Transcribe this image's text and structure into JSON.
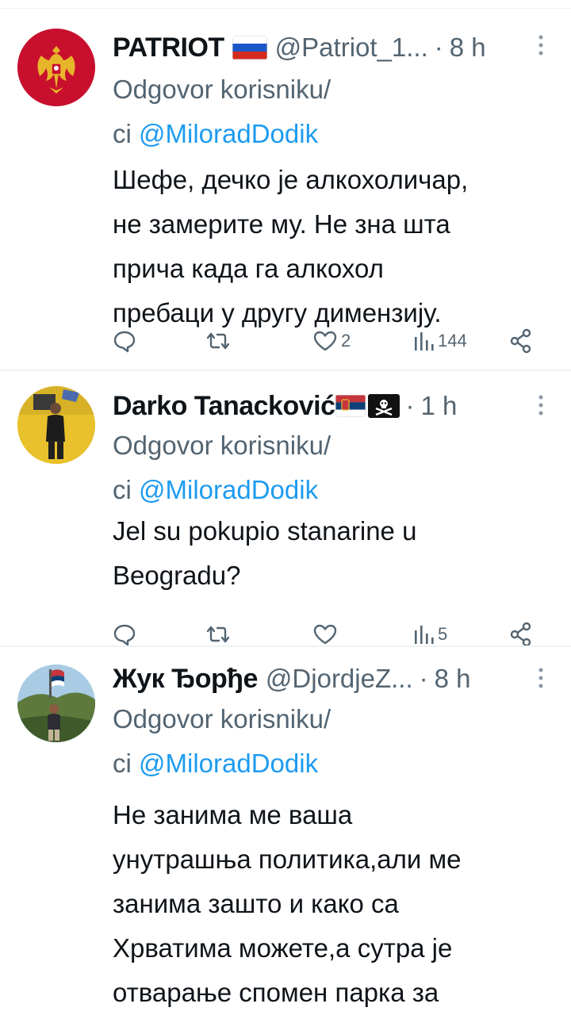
{
  "reply_prefix": "Odgovor korisniku/",
  "reply_prefix2": "ci",
  "tweets": [
    {
      "display_name": "PATRIOT",
      "handle": "@Patriot_1...",
      "time": "8 h",
      "reply_mention": "@MiloradDodik",
      "lines": [
        "Шефе, дечко је алкохоличар,",
        "не замерите му. Не зна шта",
        "прича када га алкохол",
        "пребаци у другу димензију."
      ],
      "likes": "2",
      "views": "144"
    },
    {
      "display_name": "Darko Tanacković",
      "handle": "",
      "time": "1 h",
      "reply_mention": "@MiloradDodik",
      "lines": [
        "Jel su pokupio stanarine u",
        "Beogradu?"
      ],
      "likes": "",
      "views": "5"
    },
    {
      "display_name": "Жук Ђорђе",
      "handle": "@DjordjeZ...",
      "time": "8 h",
      "reply_mention": "@MiloradDodik",
      "lines": [
        "Не занима ме ваша",
        "унутрашња политика,али ме",
        "занима зашто и како са",
        "Хрватима можете,а сутра је",
        "отварање спомен парка за"
      ],
      "likes": "",
      "views": ""
    }
  ],
  "icons": [
    "more-icon",
    "reply-icon",
    "retweet-icon",
    "like-icon",
    "views-icon",
    "share-icon"
  ],
  "colors": {
    "text": "#0f1419",
    "secondary": "#536471",
    "link": "#1d9bf0"
  }
}
